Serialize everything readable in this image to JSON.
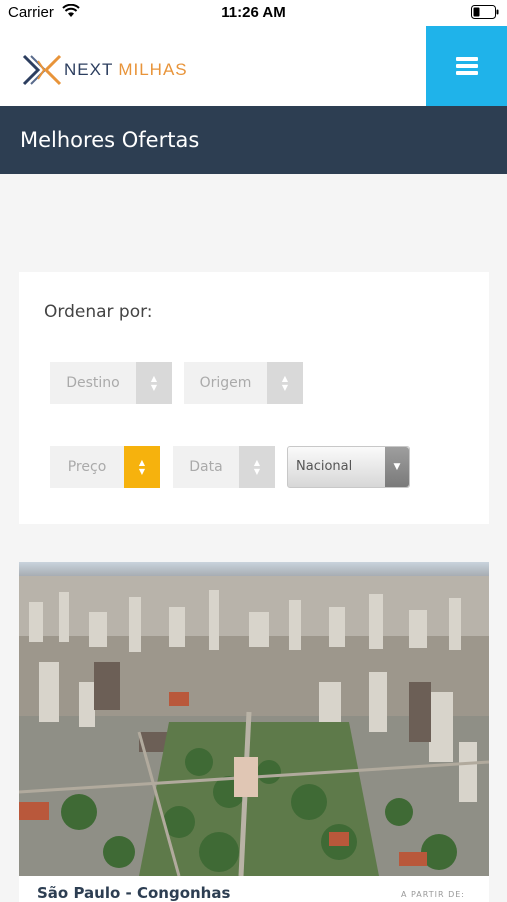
{
  "status_bar": {
    "carrier": "Carrier",
    "time": "11:26 AM"
  },
  "header": {
    "logo_next": "NEXT",
    "logo_milhas": "MILHAS",
    "menu_icon": "hamburger-menu-icon",
    "menu_color": "#1fb3ea"
  },
  "title_bar": {
    "title": "Melhores Ofertas",
    "background": "#2d3e52"
  },
  "sort": {
    "label": "Ordenar por:",
    "options": {
      "destino": "Destino",
      "origem": "Origem",
      "preco": "Preço",
      "data": "Data"
    },
    "active_option": "Preço",
    "active_color": "#f6b20d",
    "region_select": "Nacional"
  },
  "offer": {
    "image": "city-aerial-photo",
    "route": "São Paulo - Congonhas",
    "from_label": "A PARTIR DE:"
  }
}
